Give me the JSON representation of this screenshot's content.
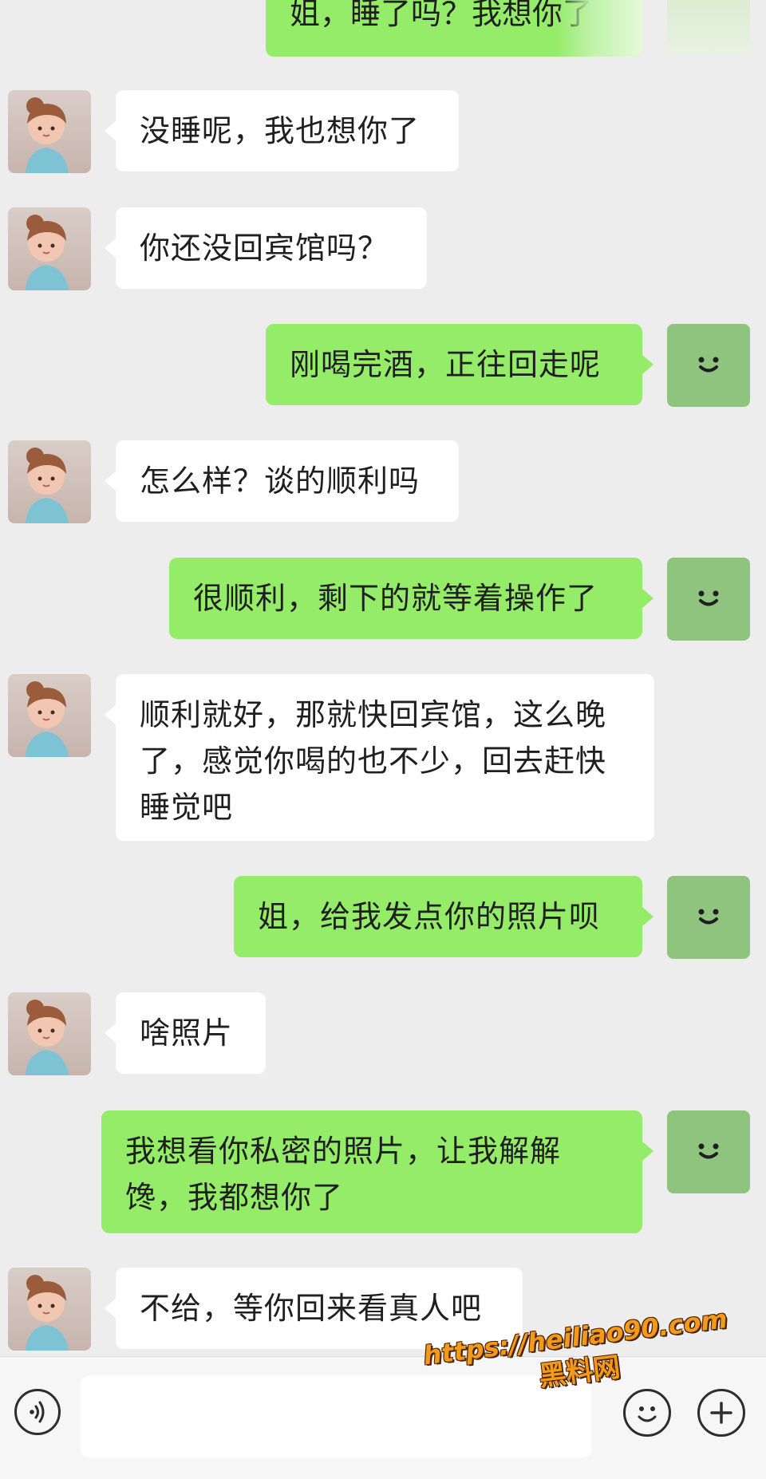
{
  "chat": {
    "top_partial_message": "姐，睡了吗？我想你了",
    "messages": [
      {
        "side": "in",
        "text": "没睡呢，我也想你了"
      },
      {
        "side": "in",
        "text": "你还没回宾馆吗？"
      },
      {
        "side": "out",
        "text": "刚喝完酒，正往回走呢"
      },
      {
        "side": "in",
        "text": "怎么样？谈的顺利吗"
      },
      {
        "side": "out",
        "text": "很顺利，剩下的就等着操作了"
      },
      {
        "side": "in",
        "text": "顺利就好，那就快回宾馆，这么晚了，感觉你喝的也不少，回去赶快睡觉吧"
      },
      {
        "side": "out",
        "text": "姐，给我发点你的照片呗"
      },
      {
        "side": "in",
        "text": "啥照片"
      },
      {
        "side": "out",
        "text": "我想看你私密的照片，让我解解馋，我都想你了"
      },
      {
        "side": "in",
        "text": "不给，等你回来看真人吧"
      }
    ]
  },
  "input_bar": {
    "icons": [
      "voice-icon",
      "emoji-icon",
      "plus-icon"
    ]
  },
  "watermark": {
    "url": "https://heiliao90.com",
    "site_name": "黑料网"
  },
  "colors": {
    "background": "#ededed",
    "incoming_bubble": "#ffffff",
    "outgoing_bubble": "#95ec69",
    "text": "#1f1f1f",
    "watermark": "#f39a1a"
  }
}
